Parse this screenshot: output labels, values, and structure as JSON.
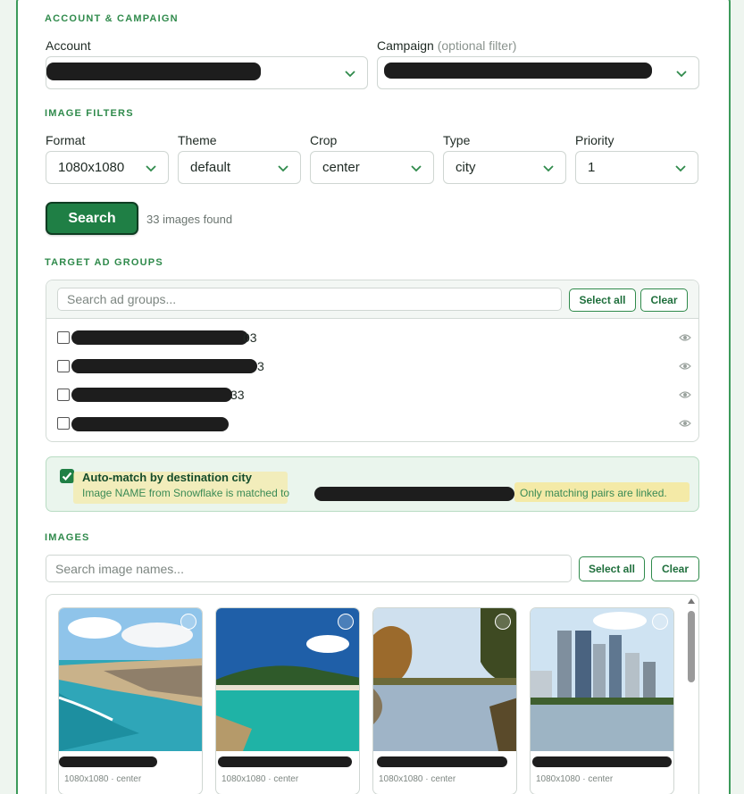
{
  "sections": {
    "account_campaign": "ACCOUNT & CAMPAIGN",
    "image_filters": "IMAGE FILTERS",
    "target_ad_groups": "TARGET AD GROUPS",
    "images": "IMAGES"
  },
  "account": {
    "label": "Account",
    "value": ""
  },
  "campaign": {
    "label": "Campaign",
    "optional_hint": "(optional filter)",
    "value": ""
  },
  "filters": {
    "format": {
      "label": "Format",
      "value": "1080x1080"
    },
    "theme": {
      "label": "Theme",
      "value": "default"
    },
    "crop": {
      "label": "Crop",
      "value": "center"
    },
    "type": {
      "label": "Type",
      "value": "city"
    },
    "priority": {
      "label": "Priority",
      "value": "1"
    }
  },
  "search": {
    "label": "Search",
    "result": "33 images found"
  },
  "ad_groups": {
    "search_placeholder": "Search ad groups...",
    "select_all": "Select all",
    "clear": "Clear",
    "items": [
      {
        "suffix": "03"
      },
      {
        "suffix": "3"
      },
      {
        "suffix": "33"
      },
      {
        "suffix": ""
      }
    ]
  },
  "auto_match": {
    "title": "Auto-match by destination city",
    "desc_start": "Image NAME from Snowflake is matched to",
    "desc_end": "Only matching pairs are linked.",
    "checked": true
  },
  "images": {
    "search_placeholder": "Search image names...",
    "select_all": "Select all",
    "clear": "Clear",
    "cards": [
      {
        "meta": "1080x1080 · center"
      },
      {
        "meta": "1080x1080 · center"
      },
      {
        "meta": "1080x1080 · center"
      },
      {
        "meta": "1080x1080 · center"
      }
    ]
  },
  "colors": {
    "accent": "#1f7f45",
    "section_title": "#2f8a4b",
    "highlight": "#f6e79a"
  }
}
